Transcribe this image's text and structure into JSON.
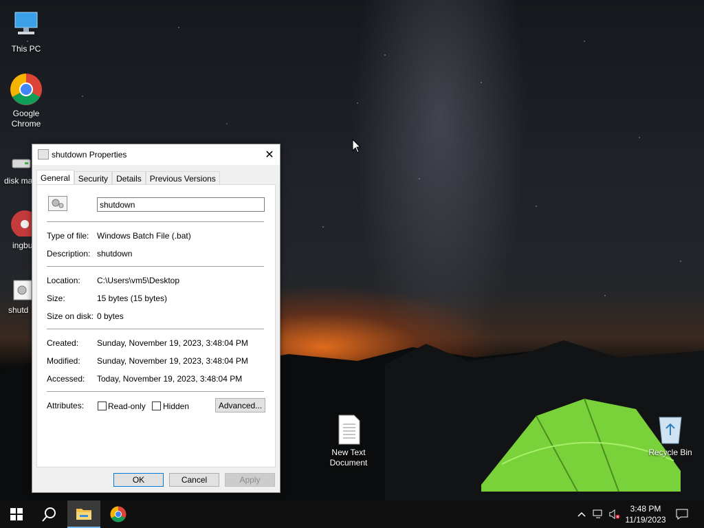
{
  "desktop": {
    "icons": [
      {
        "label": "This PC"
      },
      {
        "label": "Google Chrome"
      },
      {
        "label": "disk ma"
      },
      {
        "label": "ingbu"
      },
      {
        "label": "shutd"
      },
      {
        "label": "New Text Document"
      },
      {
        "label": "Recycle Bin"
      }
    ]
  },
  "dialog": {
    "title": "shutdown Properties",
    "close_glyph": "✕",
    "tabs": [
      "General",
      "Security",
      "Details",
      "Previous Versions"
    ],
    "active_tab": "General",
    "file_name": "shutdown",
    "rows": {
      "type_label": "Type of file:",
      "type_value": "Windows Batch File (.bat)",
      "desc_label": "Description:",
      "desc_value": "shutdown",
      "location_label": "Location:",
      "location_value": "C:\\Users\\vm5\\Desktop",
      "size_label": "Size:",
      "size_value": "15 bytes (15 bytes)",
      "size_disk_label": "Size on disk:",
      "size_disk_value": "0 bytes",
      "created_label": "Created:",
      "created_value": "Sunday, November 19, 2023, 3:48:04 PM",
      "modified_label": "Modified:",
      "modified_value": "Sunday, November 19, 2023, 3:48:04 PM",
      "accessed_label": "Accessed:",
      "accessed_value": "Today, November 19, 2023, 3:48:04 PM",
      "attributes_label": "Attributes:",
      "readonly_label": "Read-only",
      "readonly_checked": false,
      "hidden_label": "Hidden",
      "hidden_checked": false,
      "advanced_label": "Advanced..."
    },
    "buttons": {
      "ok": "OK",
      "cancel": "Cancel",
      "apply": "Apply"
    }
  },
  "taskbar": {
    "items": [
      "start-icon",
      "search-icon",
      "file-explorer-icon",
      "chrome-icon"
    ],
    "active_item": "file-explorer-icon",
    "tray_icons": [
      "chevron-up-icon",
      "network-icon",
      "volume-muted-icon",
      "notifications-icon"
    ],
    "time": "3:48 PM",
    "date": "11/19/2023"
  },
  "colors": {
    "accent": "#0078d7",
    "taskbar": "#101010",
    "tent_green": "#7ad23a"
  }
}
